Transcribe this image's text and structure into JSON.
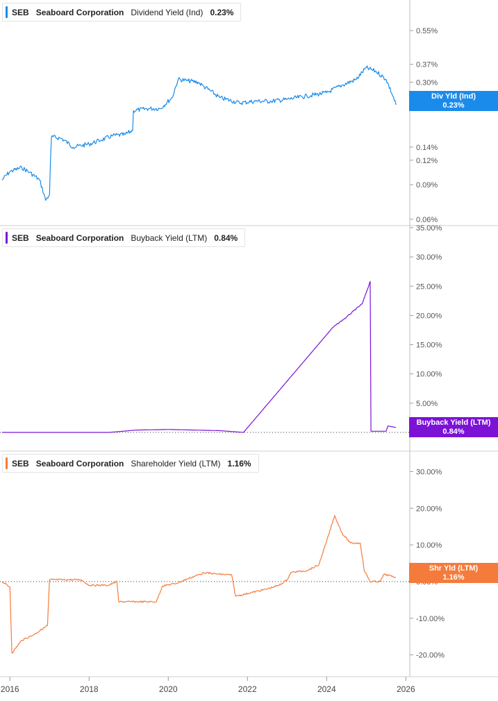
{
  "chart_data": [
    {
      "type": "line",
      "ticker": "SEB",
      "company": "Seaboard Corporation",
      "metric": "Dividend Yield (Ind)",
      "legend_value": "0.23%",
      "end_label": "Div Yld (Ind)",
      "end_value": "0.23%",
      "color": "#1a8bea",
      "yscale": "log",
      "ylim": [
        0.058,
        0.68
      ],
      "yticks": [
        {
          "value": 0.55,
          "label": "0.55%"
        },
        {
          "value": 0.37,
          "label": "0.37%"
        },
        {
          "value": 0.3,
          "label": "0.30%"
        },
        {
          "value": 0.23,
          "label": "0.23%"
        },
        {
          "value": 0.14,
          "label": "0.14%"
        },
        {
          "value": 0.12,
          "label": "0.12%"
        },
        {
          "value": 0.09,
          "label": "0.09%"
        },
        {
          "value": 0.06,
          "label": "0.06%"
        }
      ],
      "points": [
        [
          2015.8,
          0.095
        ],
        [
          2016.0,
          0.105
        ],
        [
          2016.3,
          0.11
        ],
        [
          2016.5,
          0.104
        ],
        [
          2016.75,
          0.095
        ],
        [
          2016.9,
          0.075
        ],
        [
          2017.0,
          0.08
        ],
        [
          2017.05,
          0.158
        ],
        [
          2017.3,
          0.155
        ],
        [
          2017.6,
          0.14
        ],
        [
          2018.0,
          0.145
        ],
        [
          2018.3,
          0.152
        ],
        [
          2018.6,
          0.16
        ],
        [
          2018.9,
          0.162
        ],
        [
          2019.1,
          0.17
        ],
        [
          2019.12,
          0.215
        ],
        [
          2019.5,
          0.22
        ],
        [
          2019.8,
          0.22
        ],
        [
          2020.1,
          0.25
        ],
        [
          2020.25,
          0.31
        ],
        [
          2020.5,
          0.305
        ],
        [
          2020.75,
          0.3
        ],
        [
          2020.9,
          0.285
        ],
        [
          2021.3,
          0.25
        ],
        [
          2021.8,
          0.235
        ],
        [
          2022.2,
          0.24
        ],
        [
          2022.6,
          0.24
        ],
        [
          2023.0,
          0.245
        ],
        [
          2023.5,
          0.255
        ],
        [
          2024.0,
          0.265
        ],
        [
          2024.4,
          0.29
        ],
        [
          2024.75,
          0.31
        ],
        [
          2025.0,
          0.355
        ],
        [
          2025.25,
          0.34
        ],
        [
          2025.5,
          0.31
        ],
        [
          2025.75,
          0.23
        ]
      ]
    },
    {
      "type": "line",
      "ticker": "SEB",
      "company": "Seaboard Corporation",
      "metric": "Buyback Yield (LTM)",
      "legend_value": "0.84%",
      "end_label": "Buyback Yield (LTM)",
      "end_value": "0.84%",
      "color": "#7b12d6",
      "yscale": "linear",
      "ylim": [
        0,
        35
      ],
      "zero_line": true,
      "yticks": [
        {
          "value": 35,
          "label": "35.00%"
        },
        {
          "value": 30,
          "label": "30.00%"
        },
        {
          "value": 25,
          "label": "25.00%"
        },
        {
          "value": 20,
          "label": "20.00%"
        },
        {
          "value": 15,
          "label": "15.00%"
        },
        {
          "value": 10,
          "label": "10.00%"
        },
        {
          "value": 5,
          "label": "5.00%"
        },
        {
          "value": 0,
          "label": "0.00%"
        }
      ],
      "points": [
        [
          2015.8,
          0
        ],
        [
          2018.5,
          0
        ],
        [
          2019.2,
          0.4
        ],
        [
          2020.0,
          0.5
        ],
        [
          2021.3,
          0.3
        ],
        [
          2021.9,
          0
        ],
        [
          2024.15,
          17.9
        ],
        [
          2024.5,
          19.7
        ],
        [
          2024.9,
          22.0
        ],
        [
          2025.1,
          25.8
        ],
        [
          2025.12,
          0.2
        ],
        [
          2025.5,
          0.2
        ],
        [
          2025.55,
          1.1
        ],
        [
          2025.75,
          0.84
        ]
      ]
    },
    {
      "type": "line",
      "ticker": "SEB",
      "company": "Seaboard Corporation",
      "metric": "Shareholder Yield (LTM)",
      "legend_value": "1.16%",
      "end_label": "Shr Yld (LTM)",
      "end_value": "1.16%",
      "color": "#f47b3b",
      "yscale": "linear",
      "ylim": [
        -25,
        35
      ],
      "zero_line": true,
      "yticks": [
        {
          "value": 30,
          "label": "30.00%"
        },
        {
          "value": 20,
          "label": "20.00%"
        },
        {
          "value": 10,
          "label": "10.00%"
        },
        {
          "value": 0,
          "label": "0.00%"
        },
        {
          "value": -10,
          "label": "-10.00%"
        },
        {
          "value": -20,
          "label": "-20.00%"
        }
      ],
      "points": [
        [
          2015.8,
          0
        ],
        [
          2016.0,
          -1.5
        ],
        [
          2016.05,
          -19.5
        ],
        [
          2016.3,
          -16
        ],
        [
          2016.6,
          -14.5
        ],
        [
          2016.95,
          -12
        ],
        [
          2017.0,
          0.5
        ],
        [
          2017.5,
          0.5
        ],
        [
          2017.8,
          0.5
        ],
        [
          2018.0,
          -1
        ],
        [
          2018.5,
          -1
        ],
        [
          2018.7,
          0
        ],
        [
          2018.75,
          -5.5
        ],
        [
          2019.2,
          -5.5
        ],
        [
          2019.7,
          -5.5
        ],
        [
          2019.85,
          -1.2
        ],
        [
          2020.2,
          -0.5
        ],
        [
          2020.5,
          0.8
        ],
        [
          2020.9,
          2.4
        ],
        [
          2021.3,
          2
        ],
        [
          2021.6,
          1.8
        ],
        [
          2021.7,
          -4
        ],
        [
          2022.1,
          -3
        ],
        [
          2022.5,
          -2
        ],
        [
          2022.8,
          -1
        ],
        [
          2023.0,
          0.5
        ],
        [
          2023.1,
          2.5
        ],
        [
          2023.5,
          3
        ],
        [
          2023.8,
          4.5
        ],
        [
          2024.0,
          11
        ],
        [
          2024.2,
          18
        ],
        [
          2024.4,
          13
        ],
        [
          2024.6,
          10.5
        ],
        [
          2024.85,
          10.5
        ],
        [
          2024.95,
          3
        ],
        [
          2025.1,
          0
        ],
        [
          2025.35,
          0
        ],
        [
          2025.45,
          2
        ],
        [
          2025.75,
          1.16
        ]
      ]
    }
  ],
  "x_axis": {
    "ticks": [
      "2016",
      "2018",
      "2020",
      "2022",
      "2024",
      "2026"
    ],
    "values": [
      2016,
      2018,
      2020,
      2022,
      2024,
      2026
    ],
    "xlim": [
      2015.75,
      2026.1
    ]
  }
}
